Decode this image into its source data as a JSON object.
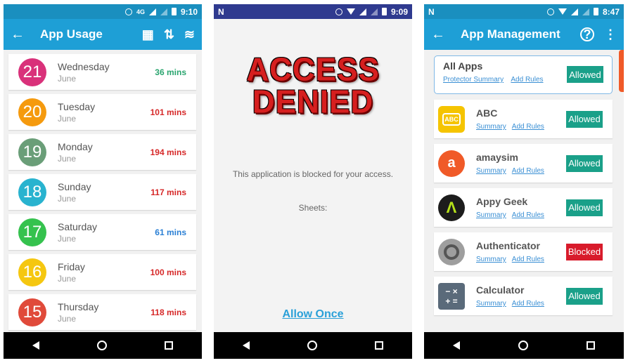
{
  "screen1": {
    "status": {
      "network": "4G",
      "time": "9:10"
    },
    "title": "App Usage",
    "days": [
      {
        "day": "21",
        "name": "Wednesday",
        "month": "June",
        "mins": "36 mins",
        "circle": "#d9317a",
        "mins_color": "#2aa56f"
      },
      {
        "day": "20",
        "name": "Tuesday",
        "month": "June",
        "mins": "101 mins",
        "circle": "#f59a0e",
        "mins_color": "#d62828"
      },
      {
        "day": "19",
        "name": "Monday",
        "month": "June",
        "mins": "194 mins",
        "circle": "#6a9e78",
        "mins_color": "#d62828"
      },
      {
        "day": "18",
        "name": "Sunday",
        "month": "June",
        "mins": "117 mins",
        "circle": "#29b3cf",
        "mins_color": "#d62828"
      },
      {
        "day": "17",
        "name": "Saturday",
        "month": "June",
        "mins": "61 mins",
        "circle": "#35c24e",
        "mins_color": "#2a7fd4"
      },
      {
        "day": "16",
        "name": "Friday",
        "month": "June",
        "mins": "100 mins",
        "circle": "#f5c710",
        "mins_color": "#d62828"
      },
      {
        "day": "15",
        "name": "Thursday",
        "month": "June",
        "mins": "118 mins",
        "circle": "#e04a3a",
        "mins_color": "#d62828"
      }
    ]
  },
  "screen2": {
    "status": {
      "app_letter": "N",
      "time": "9:09"
    },
    "denied_line1": "ACCESS",
    "denied_line2": "DENIED",
    "message": "This application is blocked for your access.",
    "sheets": "Sheets:",
    "allow_once": "Allow Once"
  },
  "screen3": {
    "status": {
      "app_letter": "N",
      "time": "8:47"
    },
    "title": "App Management",
    "all_apps": {
      "name": "All Apps",
      "link1": "Protector Summary",
      "link2": "Add Rules",
      "status": "Allowed"
    },
    "apps": [
      {
        "name": "ABC",
        "link1": "Summary",
        "link2": "Add Rules",
        "status": "Allowed",
        "icon": "abc-icon"
      },
      {
        "name": "amaysim",
        "link1": "Summary",
        "link2": "Add Rules",
        "status": "Allowed",
        "icon": "amaysim-icon"
      },
      {
        "name": "Appy Geek",
        "link1": "Summary",
        "link2": "Add Rules",
        "status": "Allowed",
        "icon": "appy-geek-icon"
      },
      {
        "name": "Authenticator",
        "link1": "Summary",
        "link2": "Add Rules",
        "status": "Blocked",
        "icon": "authenticator-icon"
      },
      {
        "name": "Calculator",
        "link1": "Summary",
        "link2": "Add Rules",
        "status": "Allowed",
        "icon": "calculator-icon"
      }
    ],
    "colors": {
      "allowed": "#1aa089",
      "blocked": "#d81b2b"
    }
  }
}
